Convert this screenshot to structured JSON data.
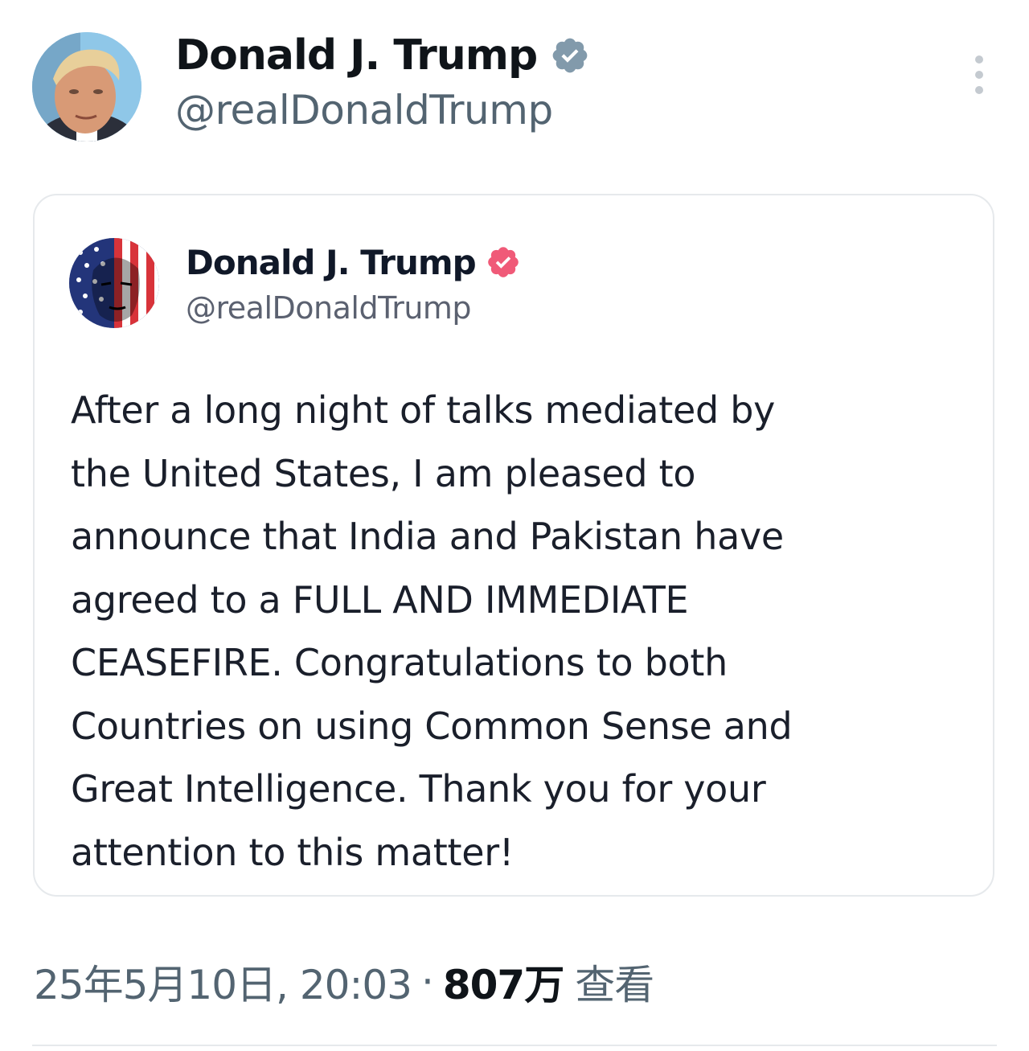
{
  "post": {
    "author": {
      "display_name": "Donald J. Trump",
      "handle": "@realDonaldTrump",
      "verified_icon": "verified-badge-icon",
      "verified_color": "#829aab"
    },
    "more_icon": "more-vertical-icon"
  },
  "quoted": {
    "author": {
      "display_name": "Donald J. Trump",
      "handle": "@realDonaldTrump",
      "verified_icon": "verified-badge-icon",
      "verified_color": "#f05a78"
    },
    "text": "After a long night of talks mediated by\nthe United States, I am pleased to\nannounce that India and Pakistan have\nagreed to a FULL AND IMMEDIATE\nCEASEFIRE. Congratulations to both\nCountries on using Common Sense and\nGreat Intelligence. Thank you for your\nattention to this matter!"
  },
  "meta": {
    "timestamp": "25年5月10日, 20:03",
    "separator": "·",
    "views_count": "807万",
    "views_label": "查看"
  }
}
